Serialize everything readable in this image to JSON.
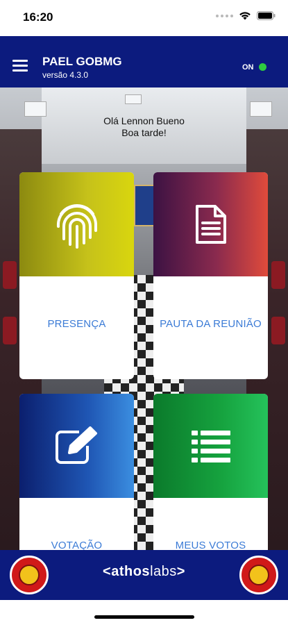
{
  "status_bar": {
    "time": "16:20",
    "icons": [
      "signal-dots-icon",
      "wifi-icon",
      "battery-icon"
    ]
  },
  "header": {
    "title": "PAEL GOBMG",
    "version": "versão 4.3.0",
    "connection_label": "ON",
    "connection_color": "#2ecc40",
    "menu_icon": "hamburger-menu-icon"
  },
  "greeting": {
    "line1": "Olá Lennon Bueno",
    "line2": "Boa tarde!"
  },
  "cards": [
    {
      "label": "PRESENÇA",
      "icon": "fingerprint-icon"
    },
    {
      "label": "PAUTA DA REUNIÃO",
      "icon": "document-icon"
    },
    {
      "label": "VOTAÇÃO",
      "icon": "edit-icon"
    },
    {
      "label": "MEUS VOTOS",
      "icon": "list-icon"
    }
  ],
  "footer": {
    "brand_bold": "athos",
    "brand_light": "labs",
    "brand_open": "<",
    "brand_close": ">"
  },
  "colors": {
    "header_bg": "#0c1b7e",
    "card_label": "#3b7bd6"
  }
}
